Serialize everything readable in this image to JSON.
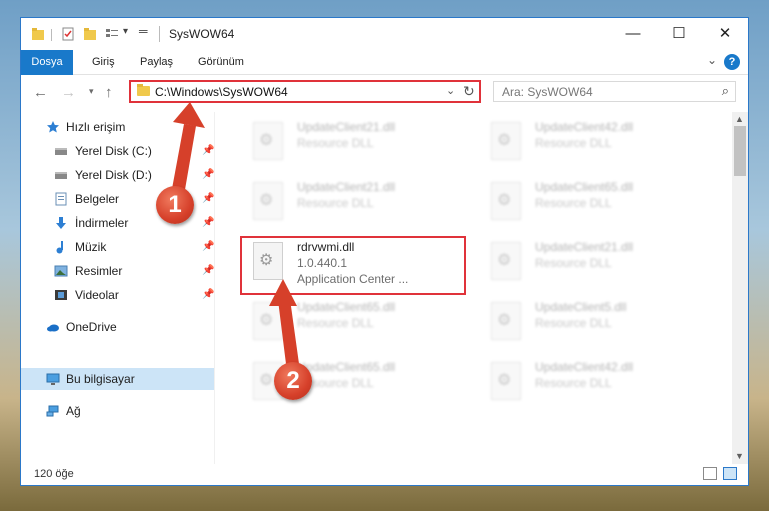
{
  "window": {
    "title": "SysWOW64",
    "controls": {
      "minimize": "—",
      "maximize": "☐",
      "close": "✕"
    }
  },
  "ribbon": {
    "tabs": [
      "Dosya",
      "Giriş",
      "Paylaş",
      "Görünüm"
    ],
    "expand_icon": "chevron-down-icon",
    "help_label": "?"
  },
  "navigation": {
    "address": "C:\\Windows\\SysWOW64",
    "search_placeholder": "Ara: SysWOW64"
  },
  "sidebar": {
    "items": [
      {
        "label": "Hızlı erişim",
        "icon": "star-icon",
        "pinned": false
      },
      {
        "label": "Yerel Disk (C:)",
        "icon": "drive-icon",
        "pinned": true
      },
      {
        "label": "Yerel Disk (D:)",
        "icon": "drive-icon",
        "pinned": true
      },
      {
        "label": "Belgeler",
        "icon": "documents-icon",
        "pinned": true
      },
      {
        "label": "İndirmeler",
        "icon": "downloads-icon",
        "pinned": true
      },
      {
        "label": "Müzik",
        "icon": "music-icon",
        "pinned": true
      },
      {
        "label": "Resimler",
        "icon": "pictures-icon",
        "pinned": true
      },
      {
        "label": "Videolar",
        "icon": "videos-icon",
        "pinned": true
      },
      {
        "label": "OneDrive",
        "icon": "cloud-icon",
        "pinned": false
      },
      {
        "label": "Bu bilgisayar",
        "icon": "computer-icon",
        "pinned": false,
        "selected": true
      },
      {
        "label": "Ağ",
        "icon": "network-icon",
        "pinned": false
      }
    ]
  },
  "files": {
    "left_column": [
      {
        "name": "UpdateClient21.dll",
        "desc": "Resource DLL",
        "blurred": true
      },
      {
        "name": "UpdateClient21.dll",
        "desc": "Resource DLL",
        "blurred": true
      },
      {
        "name": "rdrvwmi.dll",
        "desc": "1.0.440.1",
        "extra": "Application Center ...",
        "blurred": false,
        "highlighted": true
      },
      {
        "name": "UpdateClient65.dll",
        "desc": "Resource DLL",
        "blurred": true
      },
      {
        "name": "UpdateClient65.dll",
        "desc": "Resource DLL",
        "blurred": true
      }
    ],
    "right_column": [
      {
        "name": "UpdateClient42.dll",
        "desc": "Resource DLL",
        "blurred": true
      },
      {
        "name": "UpdateClient65.dll",
        "desc": "Resource DLL",
        "blurred": true
      },
      {
        "name": "UpdateClient21.dll",
        "desc": "Resource DLL",
        "blurred": true
      },
      {
        "name": "UpdateClient5.dll",
        "desc": "Resource DLL",
        "blurred": true
      },
      {
        "name": "UpdateClient42.dll",
        "desc": "Resource DLL",
        "blurred": true
      }
    ]
  },
  "status": {
    "item_count": "120 öğe"
  },
  "callouts": [
    {
      "label": "1",
      "target": "address-bar"
    },
    {
      "label": "2",
      "target": "rdrvwmi.dll"
    }
  ],
  "colors": {
    "accent": "#1979ca",
    "highlight_border": "#e0323a",
    "selected_nav": "#cce4f7",
    "callout": "#d6402a"
  }
}
